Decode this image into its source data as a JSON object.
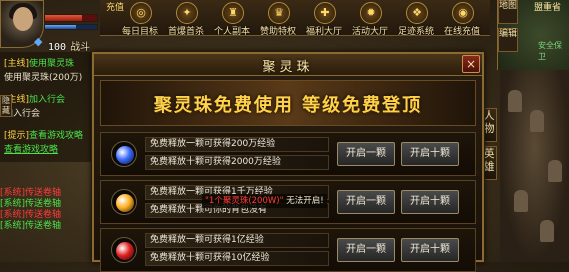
{
  "hud": {
    "power_value": "100",
    "power_label": "战斗",
    "hp_fraction": 0.72,
    "mp_fraction": 0.6,
    "recharge_label": "充值"
  },
  "top_menu": [
    {
      "label": "每日目标",
      "icon": "target-icon"
    },
    {
      "label": "首爆首杀",
      "icon": "sword-icon"
    },
    {
      "label": "个人副本",
      "icon": "dungeon-icon"
    },
    {
      "label": "赞助特权",
      "icon": "vip-icon"
    },
    {
      "label": "福利大厅",
      "icon": "gift-icon"
    },
    {
      "label": "活动大厅",
      "icon": "event-icon"
    },
    {
      "label": "足迹系统",
      "icon": "footprint-icon"
    },
    {
      "label": "在线充值",
      "icon": "coin-icon"
    }
  ],
  "minimap": {
    "location": "盟重省",
    "map_label": "地图",
    "edit_label": "编辑",
    "tower_label": "安全保卫"
  },
  "side_tabs": [
    {
      "label": "人物"
    },
    {
      "label": "英雄"
    }
  ],
  "tasks": [
    {
      "tag": "[主线]",
      "text": "使用聚灵珠",
      "style": "hl"
    },
    {
      "tag": "",
      "text": "使用聚灵珠(200万)",
      "style": "hl"
    },
    {
      "tag": "[主线]",
      "text": "加入行会",
      "style": "hl"
    },
    {
      "tag": "",
      "text": "加入行会",
      "style": "plain"
    },
    {
      "tag": "[提示]",
      "text": "查看游戏攻略",
      "style": "hl"
    },
    {
      "tag": "",
      "text": "查看游戏攻略",
      "style": "link"
    }
  ],
  "hide_label": "隐藏",
  "chat": [
    {
      "text": "[系统]传送卷轴",
      "color": "r"
    },
    {
      "text": "[系统]传送卷轴",
      "color": "g"
    },
    {
      "text": "[系统]传送卷轴",
      "color": "r"
    },
    {
      "text": "[系统]传送卷轴",
      "color": "g"
    }
  ],
  "dialog": {
    "title": "聚灵珠",
    "close": "×",
    "banner": "聚灵珠免费使用  等级免费登顶",
    "options": [
      {
        "orb_color": "#3a6aff",
        "line1": "免费释放一颗可获得200万经验",
        "line2": "免费释放十颗可获得2000万经验",
        "btn1": "开启一颗",
        "btn2": "开启十颗"
      },
      {
        "orb_color": "#ffb020",
        "line1": "免费释放一颗可获得1千万经验",
        "line2": "免费释放十颗可你的背包没有",
        "btn1": "开启一颗",
        "btn2": "开启十颗"
      },
      {
        "orb_color": "#e02020",
        "line1": "免费释放一颗可获得1亿经验",
        "line2": "免费释放十颗可获得10亿经验",
        "btn1": "开启一颗",
        "btn2": "开启十颗"
      }
    ],
    "tooltip_item": "\"1个聚灵珠(200W)\"",
    "tooltip_tail": "无法开启!"
  }
}
